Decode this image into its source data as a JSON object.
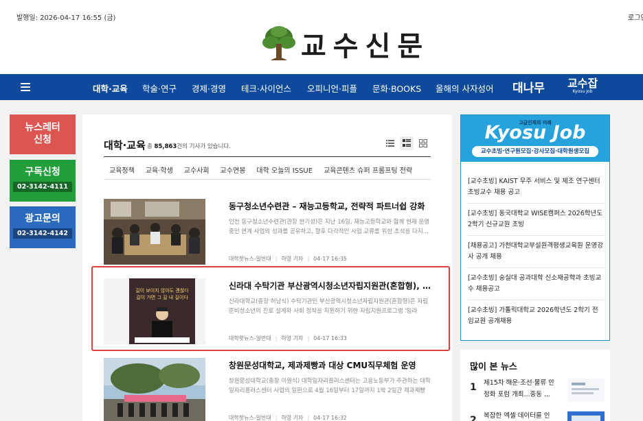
{
  "header": {
    "pubdate": "발행일: 2026-04-17 16:55 (금)",
    "login": "로그인",
    "logo_text": "교수신문"
  },
  "nav": {
    "items": [
      "대학·교육",
      "학술·연구",
      "경제·경영",
      "테크·사이언스",
      "오피니언·피플",
      "문화·BOOKS",
      "올해의 사자성어"
    ],
    "brand1": "대나무",
    "brand2": "교수잡",
    "brand2_sub": "Kyosu Job"
  },
  "side_buttons": {
    "newsletter": "뉴스레터 신청",
    "subscribe": "구독신청",
    "subscribe_phone": "02-3142-4111",
    "ad": "광고문의",
    "ad_phone": "02-3142-4142"
  },
  "section": {
    "title": "대학·교육",
    "count_prefix": "총 ",
    "count": "85,863",
    "count_suffix": "건의 기사가 있습니다.",
    "subtabs": [
      "교육정책",
      "교육·학생",
      "교수사회",
      "교수연봉",
      "대학 오늘의 ISSUE",
      "교육콘텐츠 슈퍼 프롬프팅 전략"
    ]
  },
  "articles": [
    {
      "title": "동구청소년수련관 – 재능고등학교, 전략적 파트너쉽 강화",
      "summary": "인천 동구청소년수련관(관장 한기성)은 지난 16일, 재능고등학교와 함께 현재 운영 중인 연계 사업의 성과를 공유하고, 향후 다각적인 사업 교류를 위한 초석을 다지...",
      "category": "대학핫뉴스-일반대",
      "author": "하영 기자",
      "time": "04-17 16:35"
    },
    {
      "title": "신라대 수탁기관 부산광역시청소년자립지원관(혼합형), 박근...",
      "summary": "신라대학교(총장 허남식) 수탁기관인 부산광역시청소년자립지원관(혼합형)은 자립 준비청소년의 진로 설계와 사회 정착을 지원하기 위한 자립지원프로그램 '일라job...",
      "category": "대학핫뉴스-일반대",
      "author": "하영 기자",
      "time": "04-17 16:33",
      "thumb_text": "길이 보이지 않아도 괜찮다 길이 가면 그 길 내 길이다"
    },
    {
      "title": "창원문성대학교, 제과제빵과 대상 CMU직무체험 운영",
      "summary": "창원문성대학교(총장 이원식) 대학일자리플러스센터는 고용노동부가 주관하는 대학일자리플러스센터 사업의 일환으로 4월 16일부터 17일까지 1박 2일간 제과제빵과...",
      "category": "대학핫뉴스-일반대",
      "author": "하영 기자",
      "time": "04-17 16:32"
    }
  ],
  "kyosu_job": {
    "small": "고급인재의 미래",
    "title": "Kyosu Job",
    "tagline": "교수초빙·연구원모집·강사모집·대학원생모집",
    "items": [
      "[교수초빙] KAIST 우주 서비스 및 제조 연구센터 초빙교수 채용 공고",
      "[교수초빙] 동국대학교 WISE캠퍼스 2026학년도 2학기 신규교원 초빙",
      "[채용공고] 가천대학교부설원격평생교육원 운영강사 공개 채용",
      "[교수초빙] 숭실대 공과대학 신소재공학과 초빙교수 채용공고",
      "[교수초빙] 가톨릭대학교 2026학년도 2학기 전임교원 공개채용"
    ]
  },
  "popular": {
    "title": "많이 본 뉴스",
    "items": [
      {
        "rank": "1",
        "text": "제15차 해운·조선·물류 안정화 포럼 개최...중동 ..."
      },
      {
        "rank": "2",
        "text": "복잡한 엑셀 데이터를 인"
      }
    ]
  },
  "colors": {
    "nav_bg": "#0e4a9c",
    "newsletter": "#dd5550",
    "subscribe": "#1f9e3a",
    "ad": "#2a6bc0",
    "kyosu": "#26a3dc",
    "highlight": "#e0403a"
  }
}
